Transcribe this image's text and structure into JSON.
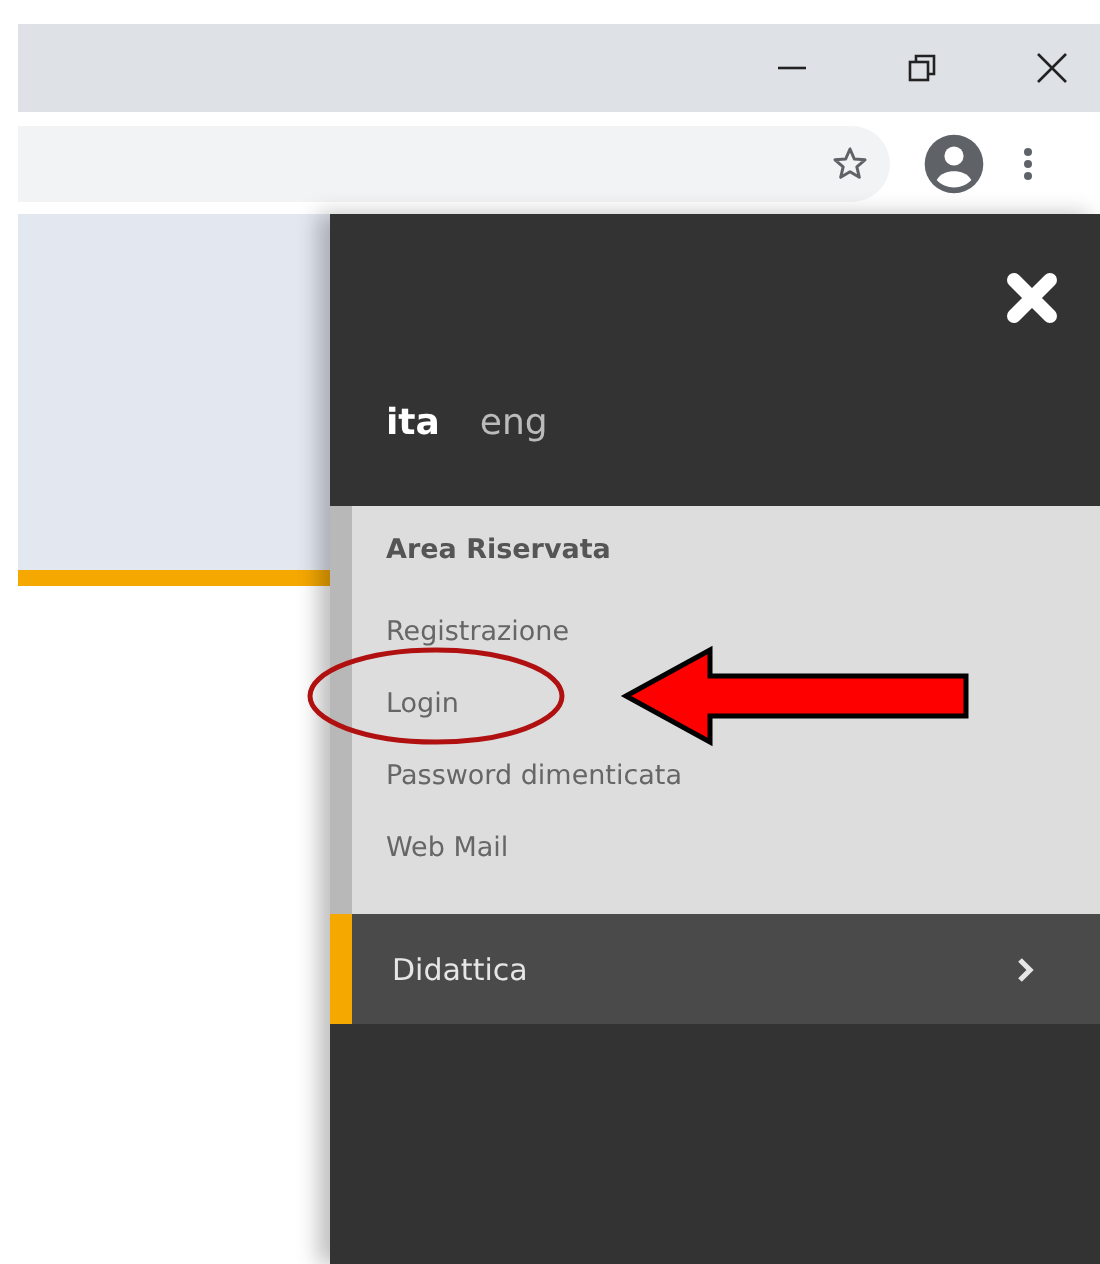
{
  "drawer": {
    "languages": [
      {
        "label": "ita",
        "selected": true
      },
      {
        "label": "eng",
        "selected": false
      }
    ],
    "section": {
      "title": "Area Riservata",
      "items": [
        "Registrazione",
        "Login",
        "Password dimenticata",
        "Web Mail"
      ]
    },
    "menu": [
      {
        "label": "Didattica",
        "active": true
      }
    ]
  },
  "annotation": {
    "kind": "circle-and-arrow"
  }
}
